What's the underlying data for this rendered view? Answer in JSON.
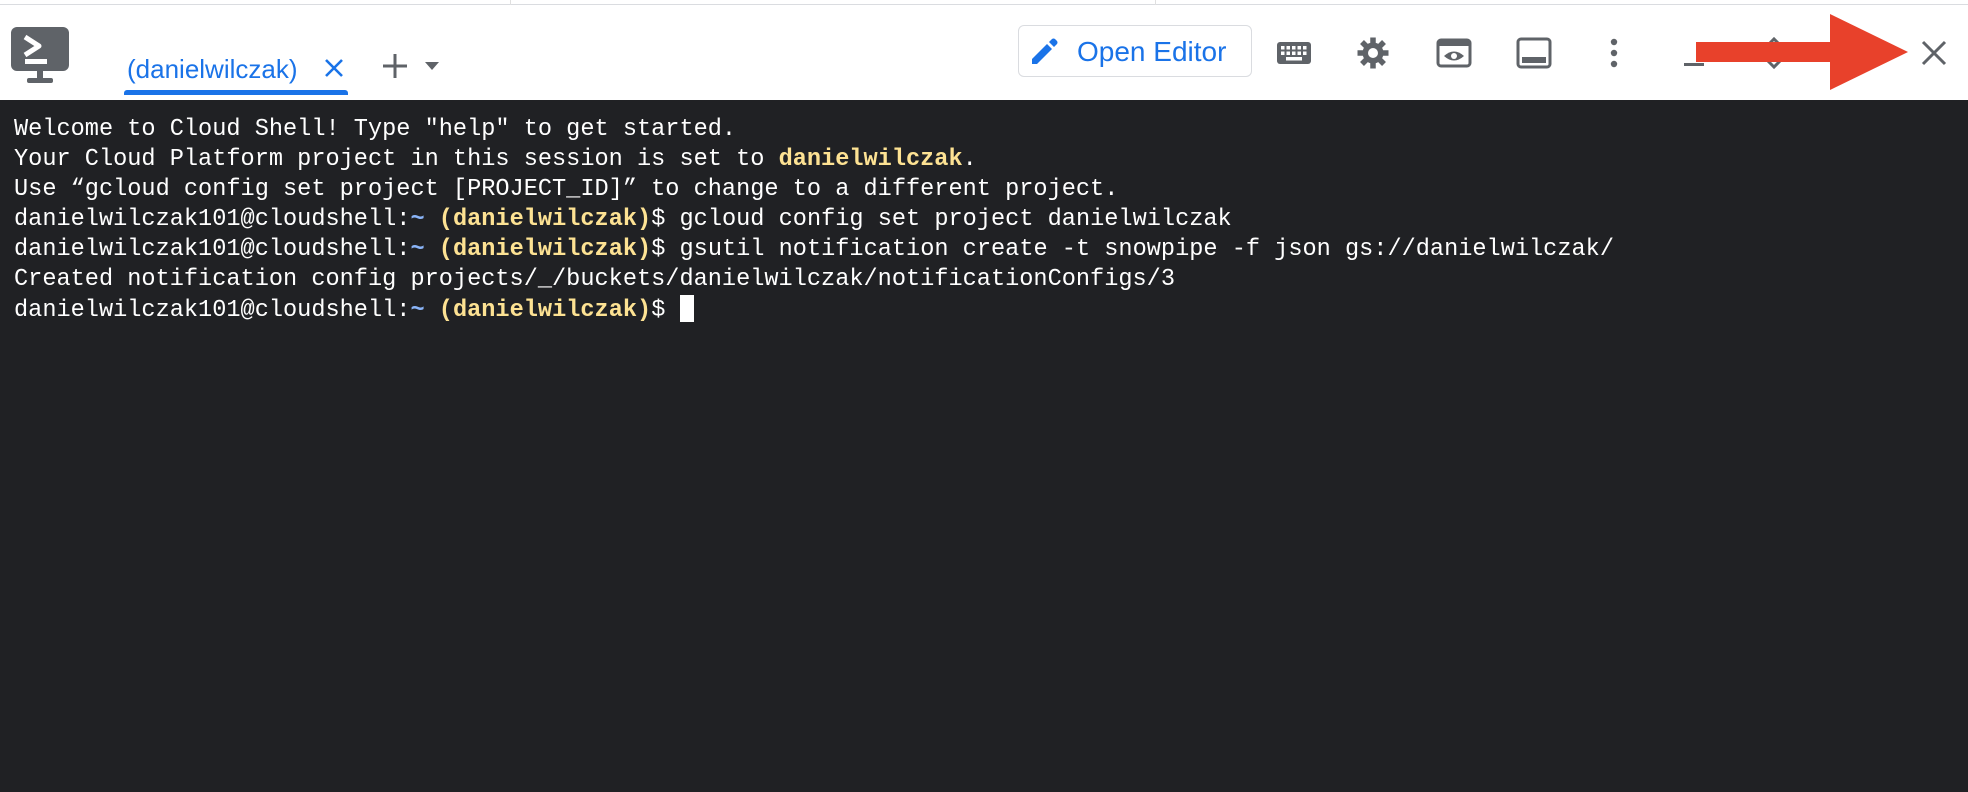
{
  "window": {
    "app_icon": "terminal-app-icon",
    "drag_handle_icon": "drag-handle-icon"
  },
  "tabs": [
    {
      "label": "(danielwilczak)",
      "active": true,
      "close_icon": "close-icon"
    }
  ],
  "toolbar": {
    "add_tab_icon": "plus-icon",
    "add_tab_menu_icon": "caret-down-icon",
    "open_editor": {
      "label": "Open Editor",
      "icon": "pencil-icon"
    },
    "icons": [
      "keyboard-icon",
      "gear-icon",
      "web-preview-icon",
      "panel-icon",
      "more-vert-icon",
      "minimize-icon",
      "restore-icon",
      "close-icon"
    ]
  },
  "terminal": {
    "line1": "Welcome to Cloud Shell! Type \"help\" to get started.",
    "line2_prefix": "Your Cloud Platform project in this session is set to ",
    "line2_project": "danielwilczak",
    "line2_suffix": ".",
    "line3": "Use “gcloud config set project [PROJECT_ID]” to change to a different project.",
    "prompt_user": "danielwilczak101@cloudshell:",
    "prompt_tilde": "~",
    "prompt_project": "(danielwilczak)",
    "prompt_symbol": "$ ",
    "cmd1": "gcloud config set project danielwilczak",
    "cmd2": "gsutil notification create -t snowpipe -f json gs://danielwilczak/",
    "output1": "Created notification config projects/_/buckets/danielwilczak/notificationConfigs/3"
  },
  "colors": {
    "accent": "#1a73e8",
    "terminal_bg": "#202124",
    "prompt_tilde": "#8ab4f8",
    "prompt_project": "#fde293",
    "annotation_arrow": "#e8412b"
  },
  "annotation": {
    "icon": "red-arrow-icon"
  }
}
